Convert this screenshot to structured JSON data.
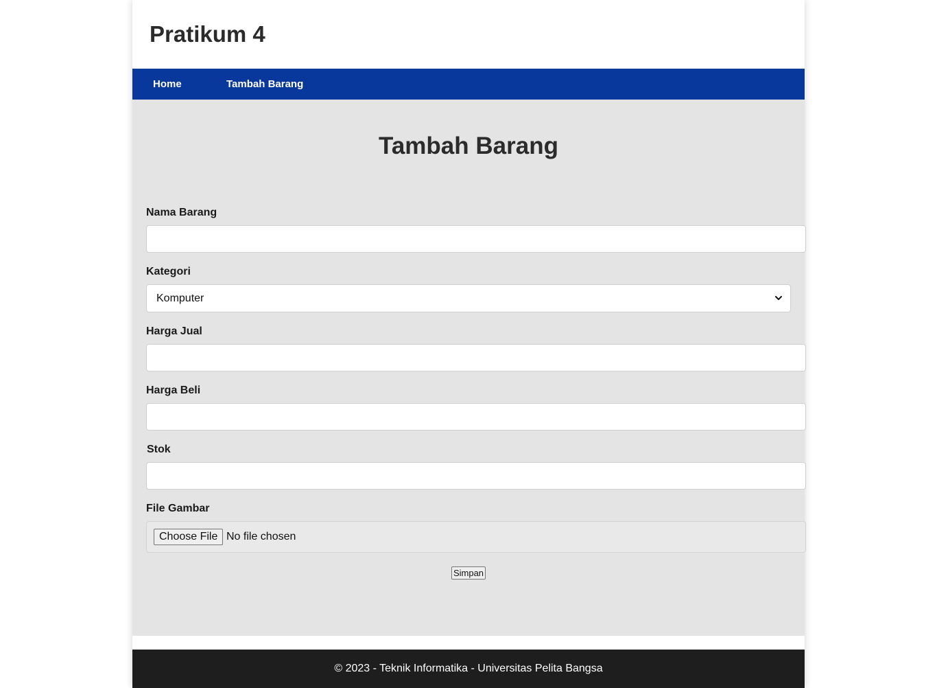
{
  "header": {
    "title": "Pratikum 4"
  },
  "nav": {
    "items": [
      {
        "label": "Home"
      },
      {
        "label": "Tambah Barang"
      }
    ]
  },
  "page": {
    "title": "Tambah Barang"
  },
  "form": {
    "nama_barang": {
      "label": "Nama Barang",
      "value": ""
    },
    "kategori": {
      "label": "Kategori",
      "selected": "Komputer"
    },
    "harga_jual": {
      "label": "Harga Jual",
      "value": ""
    },
    "harga_beli": {
      "label": "Harga Beli",
      "value": ""
    },
    "stok": {
      "label": "Stok",
      "value": ""
    },
    "file_gambar": {
      "label": "File Gambar",
      "button_label": "Choose File",
      "status": "No file chosen"
    },
    "submit_label": "Simpan"
  },
  "footer": {
    "text": "© 2023 - Teknik Informatika - Universitas Pelita Bangsa"
  },
  "colors": {
    "nav_bg": "#08389c",
    "content_bg": "#e4e4e4",
    "footer_bg": "#1e1e1e"
  },
  "icons": {
    "select_arrow": "chevron-down-icon"
  }
}
